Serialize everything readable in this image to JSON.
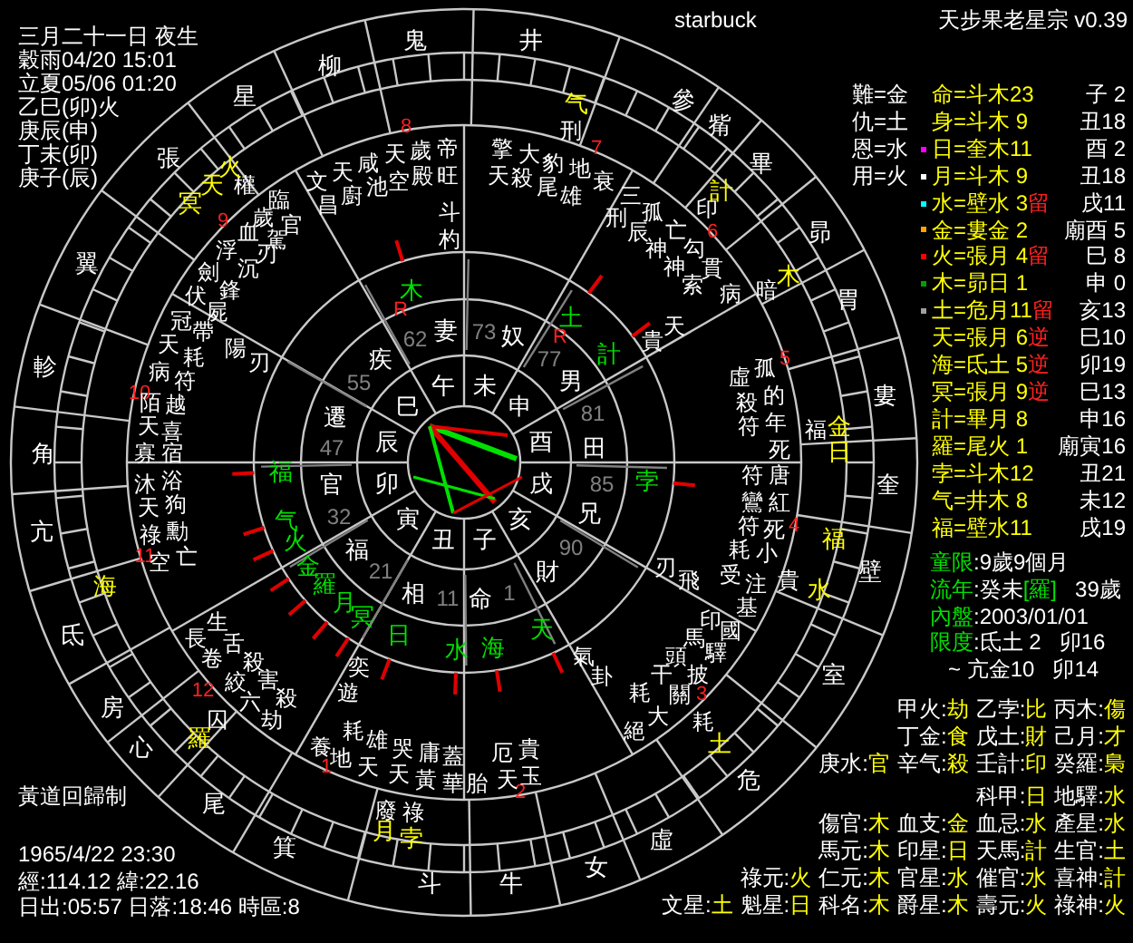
{
  "header": {
    "title": "starbuck",
    "app": "天步果老星宗 v0.39"
  },
  "birth_info": [
    "三月二十一日 夜生",
    "穀雨04/20 15:01",
    "立夏05/06 01:20",
    "乙巳(卯)火",
    "庚辰(申)",
    "丁未(卯)",
    "庚子(辰)"
  ],
  "relations": [
    "難=金",
    "仇=土",
    "恩=水",
    "用=火"
  ],
  "planets_table": [
    {
      "label": "命=斗木23",
      "position": "子 2"
    },
    {
      "label": "身=斗木 9",
      "position": "丑18"
    },
    {
      "label": "日=奎木11",
      "position": "酉 2",
      "color": "#ff00ff"
    },
    {
      "label": "月=斗木 9",
      "position": "丑18",
      "color": "#ffffff"
    },
    {
      "label": "水=壁水 3",
      "status": "留",
      "position": "戌11",
      "color": "#00ffff"
    },
    {
      "label": "金=婁金 2",
      "position": "廟酉 5",
      "color": "#ffa500"
    },
    {
      "label": "火=張月 4",
      "status": "留",
      "position": "巳 8",
      "color": "#ff0000"
    },
    {
      "label": "木=昴日 1",
      "position": "申 0",
      "color": "#00a000"
    },
    {
      "label": "土=危月11",
      "status": "留",
      "position": "亥13",
      "color": "#a0a0a0"
    },
    {
      "label": "天=張月 6",
      "status": "逆",
      "position": "巳10"
    },
    {
      "label": "海=氐土 5",
      "status": "逆",
      "position": "卯19"
    },
    {
      "label": "冥=張月 9",
      "status": "逆",
      "position": "巳13"
    },
    {
      "label": "計=畢月 8",
      "position": "申16"
    },
    {
      "label": "羅=尾火 1",
      "position": "廟寅16"
    },
    {
      "label": "孛=斗木12",
      "position": "丑21"
    },
    {
      "label": "气=井木 8",
      "position": "未12"
    },
    {
      "label": "福=壁水11",
      "position": "戌19"
    }
  ],
  "periods": [
    {
      "label": "童限",
      "value": ":9歲9個月"
    },
    {
      "label": "流年",
      "value": ":癸未",
      "tag": "[羅]",
      "extra": "39歲"
    },
    {
      "label": "內盤",
      "value": ":2003/01/01"
    },
    {
      "label": "限度",
      "value": ":氐土 2",
      "extra": "卯16"
    },
    {
      "value": "~ 亢金10",
      "extra": "卯14"
    }
  ],
  "stems": [
    [
      {
        "key": "甲火:",
        "value": "劫"
      },
      {
        "key": "乙孛:",
        "value": "比"
      },
      {
        "key": "丙木:",
        "value": "傷"
      }
    ],
    [
      {
        "key": "丁金:",
        "value": "食"
      },
      {
        "key": "戊土:",
        "value": "財"
      },
      {
        "key": "己月:",
        "value": "才"
      }
    ],
    [
      {
        "key": "庚水:",
        "value": "官"
      },
      {
        "key": "辛气:",
        "value": "殺"
      },
      {
        "key": "壬計:",
        "value": "印"
      },
      {
        "key": "癸羅:",
        "value": "梟"
      }
    ]
  ],
  "stars_table": [
    [
      {
        "key": "科甲:",
        "value": "日"
      },
      {
        "key": "地驛:",
        "value": "水"
      }
    ],
    [
      {
        "key": "傷官:",
        "value": "木"
      },
      {
        "key": "血支:",
        "value": "金"
      },
      {
        "key": "血忌:",
        "value": "水"
      },
      {
        "key": "產星:",
        "value": "水"
      }
    ],
    [
      {
        "key": "馬元:",
        "value": "木"
      },
      {
        "key": "印星:",
        "value": "日"
      },
      {
        "key": "天馬:",
        "value": "計"
      },
      {
        "key": "生官:",
        "value": "土"
      }
    ],
    [
      {
        "key": "祿元:",
        "value": "火"
      },
      {
        "key": "仁元:",
        "value": "木"
      },
      {
        "key": "官星:",
        "value": "水"
      },
      {
        "key": "催官:",
        "value": "水"
      },
      {
        "key": "喜神:",
        "value": "計"
      }
    ],
    [
      {
        "key": "文星:",
        "value": "土"
      },
      {
        "key": "魁星:",
        "value": "日"
      },
      {
        "key": "科名:",
        "value": "木"
      },
      {
        "key": "爵星:",
        "value": "木"
      },
      {
        "key": "壽元:",
        "value": "火"
      },
      {
        "key": "祿神:",
        "value": "火"
      }
    ]
  ],
  "system": "黃道回歸制",
  "location_info": [
    "1965/4/22 23:30",
    "經:114.12 緯:22.16",
    "日出:05:57 日落:18:46 時區:8"
  ],
  "chart": {
    "mansions": [
      "鬼",
      "井",
      "柳",
      "星",
      "參",
      "觜",
      "張",
      "畢",
      "昴",
      "翼",
      "胃",
      "軫",
      "婁",
      "角",
      "奎",
      "亢",
      "壁",
      "氐",
      "室",
      "房",
      "心",
      "危",
      "尾",
      "虛",
      "箕",
      "女",
      "斗",
      "牛"
    ],
    "house_numbers": [
      "8",
      "7",
      "9",
      "6",
      "5",
      "10",
      "4",
      "11",
      "12",
      "3",
      "1",
      "2"
    ],
    "stars": [
      "臨官",
      "文昌",
      "天廚",
      "咸池",
      "天空",
      "歲殿",
      "帝旺",
      "歲駕",
      "血刃",
      "浮沉",
      "劍鋒",
      "伏屍",
      "冠帶",
      "天耗",
      "病符",
      "陌越",
      "天喜",
      "寡宿",
      "沐浴",
      "天狗",
      "祿勳",
      "空亡",
      "陽刃",
      "斗杓",
      "權",
      "長生",
      "卷舌",
      "囚",
      "絞殺",
      "六害",
      "劫殺",
      "奕遊",
      "養",
      "耗地",
      "雄天",
      "哭天",
      "庸黃",
      "蓋華",
      "廢祿",
      "刑",
      "擎天",
      "大殺",
      "豹尾",
      "地雄",
      "衰",
      "三刑",
      "孤辰",
      "亡神",
      "印",
      "勾神",
      "貫索",
      "病",
      "暗",
      "貴天",
      "虛孤",
      "殺的",
      "符年",
      "死",
      "福",
      "符唐",
      "鸞紅",
      "符死",
      "刃飛",
      "耗小",
      "受注",
      "基",
      "貴",
      "印國",
      "馬驛",
      "頭披",
      "關干",
      "大耗",
      "絕",
      "耗",
      "氣卦",
      "厄天",
      "貴玉",
      "胎"
    ],
    "palaces": [
      "妻",
      "奴",
      "男",
      "田",
      "兄",
      "財",
      "命",
      "相",
      "福",
      "官",
      "遷",
      "疾"
    ],
    "degrees": [
      "62",
      "73",
      "77",
      "81",
      "85",
      "90",
      "1",
      "11",
      "21",
      "32",
      "47",
      "55"
    ],
    "branches": [
      "午",
      "未",
      "申",
      "酉",
      "戌",
      "亥",
      "子",
      "丑",
      "寅",
      "卯",
      "辰",
      "巳"
    ],
    "planets": [
      {
        "label": "木",
        "mark": "R"
      },
      {
        "label": "土",
        "mark": "R"
      },
      {
        "label": "計"
      },
      {
        "label": "福"
      },
      {
        "label": "孛"
      },
      {
        "label": "气"
      },
      {
        "label": "火"
      },
      {
        "label": "金"
      },
      {
        "label": "羅"
      },
      {
        "label": "月"
      },
      {
        "label": "冥"
      },
      {
        "label": "天"
      },
      {
        "label": "日"
      },
      {
        "label": "海"
      },
      {
        "label": "水"
      }
    ],
    "outer_planets": [
      "气",
      "火",
      "天",
      "計",
      "冥",
      "木",
      "金",
      "日",
      "福",
      "海",
      "水",
      "羅",
      "土",
      "月",
      "孛"
    ]
  }
}
